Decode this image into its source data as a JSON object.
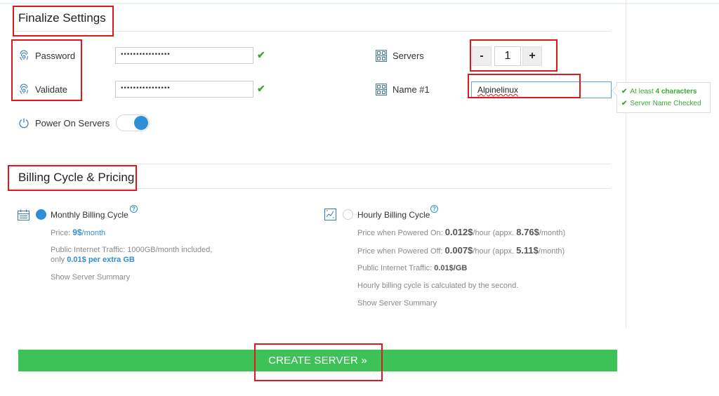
{
  "finalize": {
    "title": "Finalize Settings",
    "password_label": "Password",
    "password_value": "••••••••••••••••",
    "validate_label": "Validate",
    "validate_value": "••••••••••••••••",
    "power_label": "Power On Servers",
    "power_on": true,
    "servers_label": "Servers",
    "servers_minus": "-",
    "servers_count": "1",
    "servers_plus": "+",
    "name_label": "Name #1",
    "name_value": "Alpinelinux",
    "tooltip": {
      "line1_prefix": "At least ",
      "line1_bold": "4 characters",
      "line2": "Server Name Checked"
    }
  },
  "billing": {
    "title": "Billing Cycle & Pricing",
    "monthly": {
      "title": "Monthly Billing Cycle",
      "selected": true,
      "price_prefix": "Price: ",
      "price_value": "9$",
      "price_unit": "/month",
      "traffic_line1": "Public Internet Traffic: 1000GB/month included,",
      "traffic_prefix": "only ",
      "traffic_extra": "0.01$ per extra GB",
      "summary_link": "Show Server Summary"
    },
    "hourly": {
      "title": "Hourly Billing Cycle",
      "selected": false,
      "on_prefix": "Price when Powered On: ",
      "on_value": "0.012$",
      "on_unit": "/hour (appx. ",
      "on_month": "8.76$",
      "on_month_unit": "/month)",
      "off_prefix": "Price when Powered Off: ",
      "off_value": "0.007$",
      "off_unit": "/hour (appx. ",
      "off_month": "5.11$",
      "off_month_unit": "/month)",
      "traffic_prefix": "Public Internet Traffic: ",
      "traffic_value": "0.01$/GB",
      "note": "Hourly billing cycle is calculated by the second.",
      "summary_link": "Show Server Summary"
    }
  },
  "create_button": "CREATE SERVER »",
  "colors": {
    "accent_blue": "#2e8fd6",
    "success_green": "#3aaa35",
    "button_green": "#3cc256",
    "annotation_red": "#e0171f"
  },
  "icons": [
    "fingerprint-icon",
    "power-icon",
    "server-icon",
    "checkmark-icon",
    "help-icon",
    "calendar-icon",
    "hourly-chart-icon"
  ]
}
